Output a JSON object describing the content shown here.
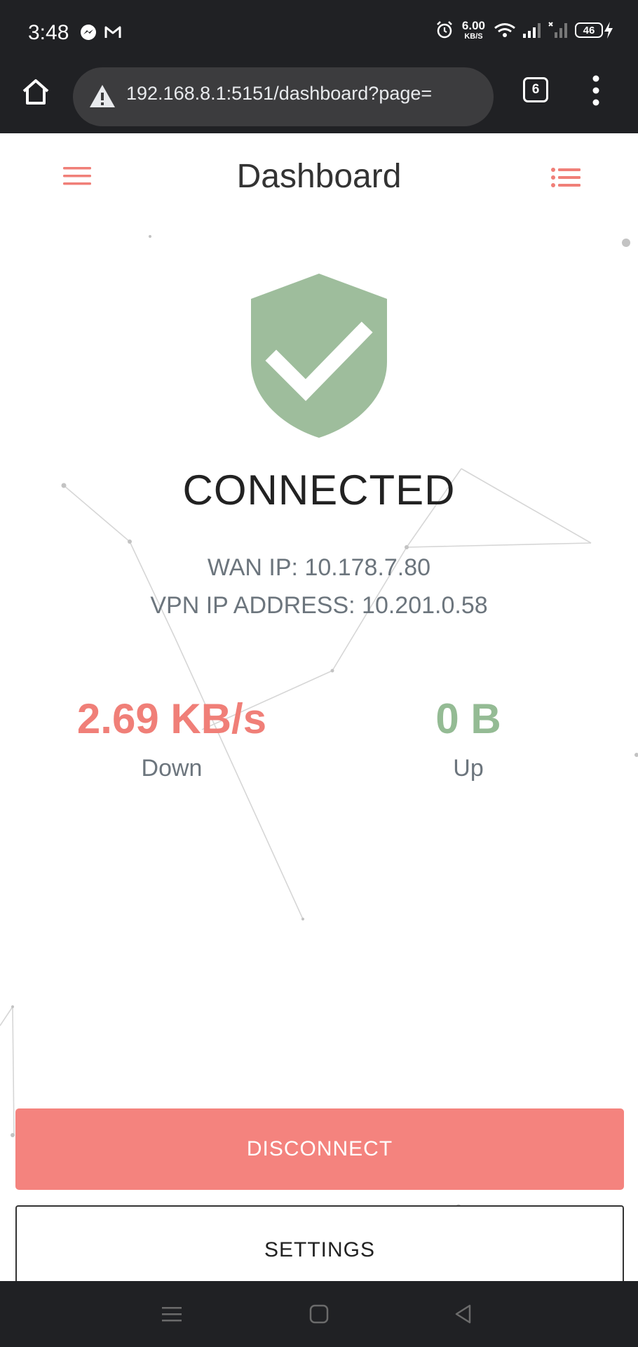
{
  "status_bar": {
    "time": "3:48",
    "net_speed_value": "6.00",
    "net_speed_unit": "KB/S",
    "battery_level": "46"
  },
  "browser": {
    "url": "192.168.8.1:5151/dashboard?page=",
    "tab_count": "6"
  },
  "header": {
    "title": "Dashboard"
  },
  "connection": {
    "status": "CONNECTED",
    "wan_ip": "WAN IP: 10.178.7.80",
    "vpn_ip": "VPN IP ADDRESS: 10.201.0.58"
  },
  "traffic": {
    "down_value": "2.69 KB/s",
    "down_label": "Down",
    "up_value": "0 B",
    "up_label": "Up"
  },
  "buttons": {
    "disconnect": "DISCONNECT",
    "settings": "SETTINGS"
  },
  "colors": {
    "accent_red": "#f4837e",
    "accent_green": "#94bb94",
    "shield_green": "#9ebd9c",
    "dark_bar": "#202124"
  }
}
